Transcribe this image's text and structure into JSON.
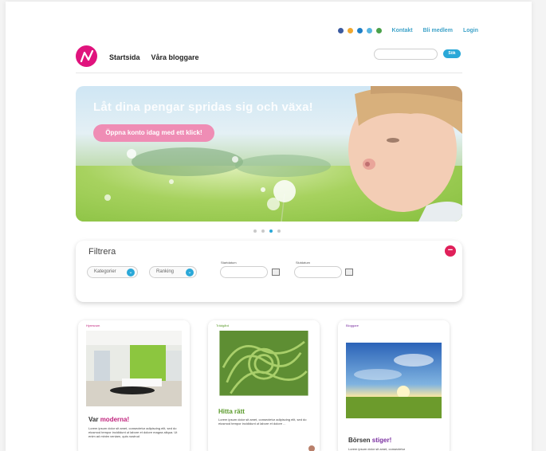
{
  "header": {
    "links": [
      "Kontakt",
      "Bli medlem",
      "Login"
    ],
    "nav": [
      "Startsida",
      "Våra bloggare"
    ],
    "search_button": "Sök",
    "social_icons": [
      "info-icon",
      "rss-icon",
      "twitter-icon",
      "facebook-icon",
      "leaf-icon"
    ],
    "social_colors": [
      "#3b5aa0",
      "#f0a830",
      "#1e7fc7",
      "#59b5e0",
      "#4aa14a"
    ]
  },
  "hero": {
    "title": "Låt dina pengar spridas sig och växa!",
    "cta": "Öppna konto idag med ett klick!",
    "slides": 4,
    "active_slide": 3
  },
  "filter": {
    "title": "Filtrera",
    "category_select": "Kategorier",
    "ranking_select": "Ranking",
    "start_date_label": "Startdatum",
    "end_date_label": "Slutdatum"
  },
  "cards": [
    {
      "category": "Hyresrum",
      "title_pre": "Var ",
      "title_hl": "moderna!",
      "text": "Lorem ipsum dolor sit amet, consectetur adipiscing elit, sed do eiusmod tempor incididunt ut labore et dolore magna aliqua. Ut enim ad minim veniam, quis nostrud",
      "accent": "#c0247d"
    },
    {
      "category": "Trädgård",
      "title_pre": "Hitta ",
      "title_hl": "rätt",
      "text": "Lorem ipsum dolor sit amet, consectetur adipiscing elit, sed do eiusmod tempor incididunt ut labore et dolore ...",
      "accent": "#5a9a2a"
    },
    {
      "category": "Bloggare",
      "title_pre": "Börsen ",
      "title_hl": "stiger!",
      "text": "Lorem ipsum dolor sit amet, consectetur",
      "accent": "#7a2fa0"
    }
  ]
}
